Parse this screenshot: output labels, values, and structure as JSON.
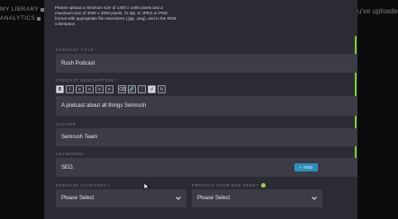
{
  "background": {
    "nav_items": [
      {
        "label": "MY LIBRARY",
        "icon": "square-icon"
      },
      {
        "label": "ANALYTICS",
        "icon": "square-icon"
      }
    ],
    "right_text": "u've uploade"
  },
  "modal": {
    "upload_notice": "Please upload a minimum size of 1400 x 1400 pixels and a maximum size of 3000 x 3000 pixels, 72 dpi, in JPEG or PNG format with appropriate file extensions (.jpg, .png), and in the RGB colorspace.",
    "podcast_title": {
      "label": "PODCAST TITLE",
      "required": "*",
      "value": "Rush Podcast"
    },
    "podcast_description": {
      "label": "PODCAST DESCRIPTION",
      "required": "*",
      "value": "A podcast about all things Semrush",
      "toolbar": [
        "B",
        "I",
        "≡",
        "≡",
        "≡",
        "≡",
        "⌫",
        "🔗",
        "⋮",
        "↺",
        "↻"
      ]
    },
    "author": {
      "label": "AUTHOR",
      "value": "Semrush Team"
    },
    "keywords": {
      "label": "KEYWORDS",
      "value": "SEO,",
      "add_label": "+ ADD"
    },
    "podcast_category": {
      "label": "PODCAST CATEGORY",
      "required": "*",
      "value": "Please Select"
    },
    "protect_feed": {
      "label": "PROTECT YOUR RSS FEED?",
      "value": "Please Select"
    },
    "colors": {
      "accent": "#2e8fbf",
      "scrollbar": "#7fcf3a",
      "status": "#9ed05a",
      "required": "#e0524e"
    }
  }
}
